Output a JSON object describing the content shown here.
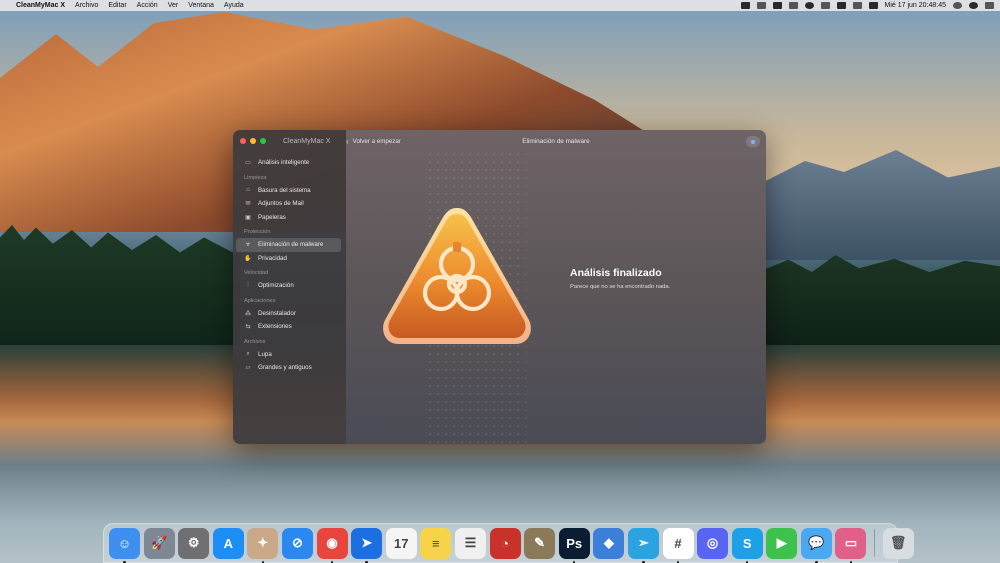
{
  "menubar": {
    "apple_icon": "",
    "items": [
      "CleanMyMac X",
      "Archivo",
      "Editar",
      "Acción",
      "Ver",
      "Ventana",
      "Ayuda"
    ],
    "clock": "Mié 17 jun  20:48:45"
  },
  "window": {
    "app_title": "CleanMyMac X",
    "back_label": "Volver a empezar",
    "title": "Eliminación de malware",
    "result_title": "Análisis finalizado",
    "result_subtitle": "Parece que no se ha encontrado nada."
  },
  "sidebar": {
    "top_item": {
      "label": "Análisis inteligente",
      "icon": "monitor-icon"
    },
    "groups": [
      {
        "label": "Limpieza",
        "items": [
          {
            "label": "Basura del sistema",
            "icon": "trash-can-icon"
          },
          {
            "label": "Adjuntos de Mail",
            "icon": "envelope-icon"
          },
          {
            "label": "Papeleras",
            "icon": "bin-icon"
          }
        ]
      },
      {
        "label": "Protección",
        "items": [
          {
            "label": "Eliminación de malware",
            "icon": "biohazard-icon",
            "active": true
          },
          {
            "label": "Privacidad",
            "icon": "hand-icon"
          }
        ]
      },
      {
        "label": "Velocidad",
        "items": [
          {
            "label": "Optimización",
            "icon": "sliders-icon"
          }
        ]
      },
      {
        "label": "Aplicaciones",
        "items": [
          {
            "label": "Desinstalador",
            "icon": "apps-icon"
          },
          {
            "label": "Extensiones",
            "icon": "puzzle-icon"
          }
        ]
      },
      {
        "label": "Archivos",
        "items": [
          {
            "label": "Lupa",
            "icon": "magnifier-icon"
          },
          {
            "label": "Grandes y antiguos",
            "icon": "folder-icon"
          }
        ]
      }
    ]
  },
  "dock": {
    "apps": [
      {
        "name": "finder-icon",
        "color": "#3f8ff0",
        "glyph": "☺",
        "running": true
      },
      {
        "name": "launchpad-icon",
        "color": "#7d8894",
        "glyph": "🚀"
      },
      {
        "name": "system-preferences-icon",
        "color": "#6e6e73",
        "glyph": "⚙"
      },
      {
        "name": "app-store-icon",
        "color": "#1c8ef5",
        "glyph": "A"
      },
      {
        "name": "cleanmymac-icon",
        "color": "#c9a98a",
        "glyph": "✦",
        "running": true
      },
      {
        "name": "safari-icon",
        "color": "#2a88f0",
        "glyph": "⊘"
      },
      {
        "name": "chrome-icon",
        "color": "#e8453c",
        "glyph": "◉",
        "running": true
      },
      {
        "name": "spark-icon",
        "color": "#1b6fe0",
        "glyph": "➤",
        "running": true
      },
      {
        "name": "calendar-icon",
        "color": "#f5f5f5",
        "glyph": "17"
      },
      {
        "name": "notes-icon",
        "color": "#f7d34a",
        "glyph": "≡"
      },
      {
        "name": "reminders-icon",
        "color": "#f0f0f0",
        "glyph": "☰"
      },
      {
        "name": "disk-diag-icon",
        "color": "#c8322b",
        "glyph": "◔"
      },
      {
        "name": "gimp-icon",
        "color": "#8a7a5a",
        "glyph": "✎"
      },
      {
        "name": "photoshop-icon",
        "color": "#0b1d33",
        "glyph": "Ps",
        "running": true
      },
      {
        "name": "xcode-helper-icon",
        "color": "#3b7fd8",
        "glyph": "◆"
      },
      {
        "name": "telegram-icon",
        "color": "#2aa3e0",
        "glyph": "➣",
        "running": true
      },
      {
        "name": "slack-icon",
        "color": "#ffffff",
        "glyph": "#",
        "running": true
      },
      {
        "name": "discord-icon",
        "color": "#5865f2",
        "glyph": "◎"
      },
      {
        "name": "skype-icon",
        "color": "#1da0e6",
        "glyph": "S",
        "running": true
      },
      {
        "name": "facetime-icon",
        "color": "#3cc24d",
        "glyph": "▶"
      },
      {
        "name": "messages-icon",
        "color": "#4aa8f0",
        "glyph": "💬",
        "running": true
      },
      {
        "name": "cleanmymac-menu-icon",
        "color": "#e0608a",
        "glyph": "▭",
        "running": true
      }
    ],
    "trash": {
      "name": "trash-icon",
      "color": "#d8dde2",
      "glyph": "🗑"
    }
  },
  "colors": {
    "accent_orange": "#f2a23a",
    "active_item_bg": "rgba(255,255,255,0.14)"
  }
}
